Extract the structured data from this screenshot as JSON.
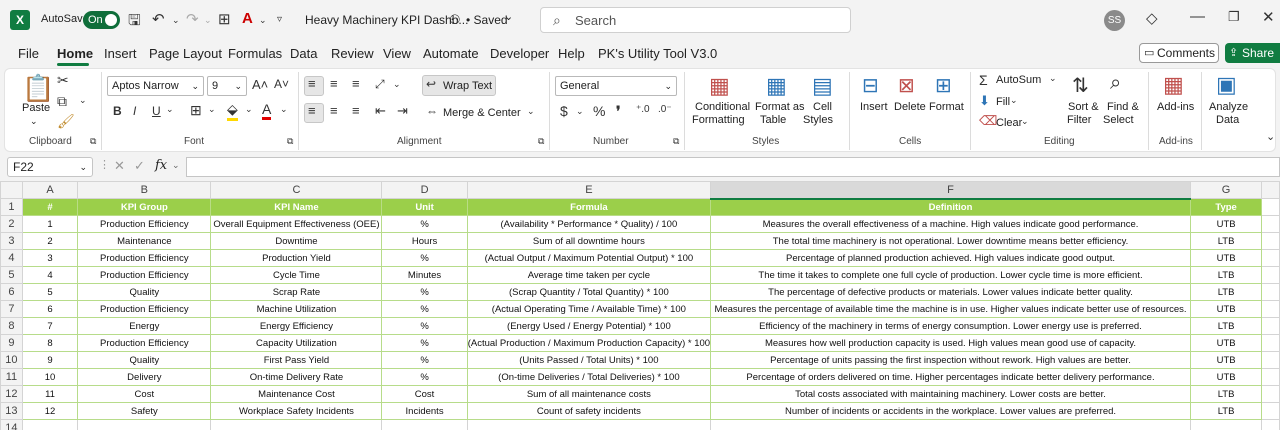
{
  "titlebar": {
    "autosave_label": "AutoSave",
    "toggle_state": "On",
    "filename": "Heavy Machinery KPI Dashb...",
    "saved_status": "• Saved",
    "search_placeholder": "Search",
    "avatar_initials": "SS"
  },
  "menu": {
    "items": [
      "File",
      "Home",
      "Insert",
      "Page Layout",
      "Formulas",
      "Data",
      "Review",
      "View",
      "Automate",
      "Developer",
      "Help",
      "PK's Utility Tool V3.0"
    ],
    "active": "Home",
    "comments": "Comments",
    "share": "Share"
  },
  "ribbon": {
    "clipboard": {
      "paste": "Paste",
      "label": "Clipboard"
    },
    "font": {
      "name": "Aptos Narrow",
      "size": "9",
      "label": "Font"
    },
    "alignment": {
      "wrap": "Wrap Text",
      "merge": "Merge & Center",
      "label": "Alignment"
    },
    "number": {
      "format": "General",
      "label": "Number"
    },
    "styles": {
      "cond1": "Conditional",
      "cond2": "Formatting",
      "fmt1": "Format as",
      "fmt2": "Table",
      "cell1": "Cell",
      "cell2": "Styles",
      "label": "Styles"
    },
    "cells": {
      "insert": "Insert",
      "delete": "Delete",
      "format": "Format",
      "label": "Cells"
    },
    "editing": {
      "autosum": "AutoSum",
      "fill": "Fill",
      "clear": "Clear",
      "sort1": "Sort &",
      "sort2": "Filter",
      "find1": "Find &",
      "find2": "Select",
      "label": "Editing"
    },
    "addins": {
      "addins": "Add-ins",
      "label": "Add-ins"
    },
    "analyze": {
      "l1": "Analyze",
      "l2": "Data"
    }
  },
  "formula_bar": {
    "cell_ref": "F22",
    "fx": "fx",
    "content": ""
  },
  "columns": [
    "A",
    "B",
    "C",
    "D",
    "E",
    "F",
    "G"
  ],
  "headers": [
    "#",
    "KPI Group",
    "KPI Name",
    "Unit",
    "Formula",
    "Definition",
    "Type"
  ],
  "rows": [
    [
      "1",
      "Production Efficiency",
      "Overall Equipment Effectiveness (OEE)",
      "%",
      "(Availability * Performance * Quality) / 100",
      "Measures the overall effectiveness of a machine. High values indicate good performance.",
      "UTB"
    ],
    [
      "2",
      "Maintenance",
      "Downtime",
      "Hours",
      "Sum of all downtime hours",
      "The total time machinery is not operational. Lower downtime means better efficiency.",
      "LTB"
    ],
    [
      "3",
      "Production Efficiency",
      "Production Yield",
      "%",
      "(Actual Output / Maximum Potential Output) * 100",
      "Percentage of planned production achieved. High values indicate good output.",
      "UTB"
    ],
    [
      "4",
      "Production Efficiency",
      "Cycle Time",
      "Minutes",
      "Average time taken per cycle",
      "The time it takes to complete one full cycle of production. Lower cycle time is more efficient.",
      "LTB"
    ],
    [
      "5",
      "Quality",
      "Scrap Rate",
      "%",
      "(Scrap Quantity / Total Quantity) * 100",
      "The percentage of defective products or materials. Lower values indicate better quality.",
      "LTB"
    ],
    [
      "6",
      "Production Efficiency",
      "Machine Utilization",
      "%",
      "(Actual Operating Time / Available Time) * 100",
      "Measures the percentage of available time the machine is in use. Higher values indicate better use of resources.",
      "UTB"
    ],
    [
      "7",
      "Energy",
      "Energy Efficiency",
      "%",
      "(Energy Used / Energy Potential) * 100",
      "Efficiency of the machinery in terms of energy consumption. Lower energy use is preferred.",
      "LTB"
    ],
    [
      "8",
      "Production Efficiency",
      "Capacity Utilization",
      "%",
      "(Actual Production / Maximum Production Capacity) * 100",
      "Measures how well production capacity is used. High values mean good use of capacity.",
      "UTB"
    ],
    [
      "9",
      "Quality",
      "First Pass Yield",
      "%",
      "(Units Passed / Total Units) * 100",
      "Percentage of units passing the first inspection without rework. High values are better.",
      "UTB"
    ],
    [
      "10",
      "Delivery",
      "On-time Delivery Rate",
      "%",
      "(On-time Deliveries / Total Deliveries) * 100",
      "Percentage of orders delivered on time. Higher percentages indicate better delivery performance.",
      "UTB"
    ],
    [
      "11",
      "Cost",
      "Maintenance Cost",
      "Cost",
      "Sum of all maintenance costs",
      "Total costs associated with maintaining machinery. Lower costs are better.",
      "LTB"
    ],
    [
      "12",
      "Safety",
      "Workplace Safety Incidents",
      "Incidents",
      "Count of safety incidents",
      "Number of incidents or accidents in the workplace. Lower values are preferred.",
      "LTB"
    ]
  ],
  "row_numbers": [
    "1",
    "2",
    "3",
    "4",
    "5",
    "6",
    "7",
    "8",
    "9",
    "10",
    "11",
    "12",
    "13",
    "14"
  ],
  "colors": {
    "header_green": "#9bcf4a",
    "excel_green": "#107c41"
  }
}
